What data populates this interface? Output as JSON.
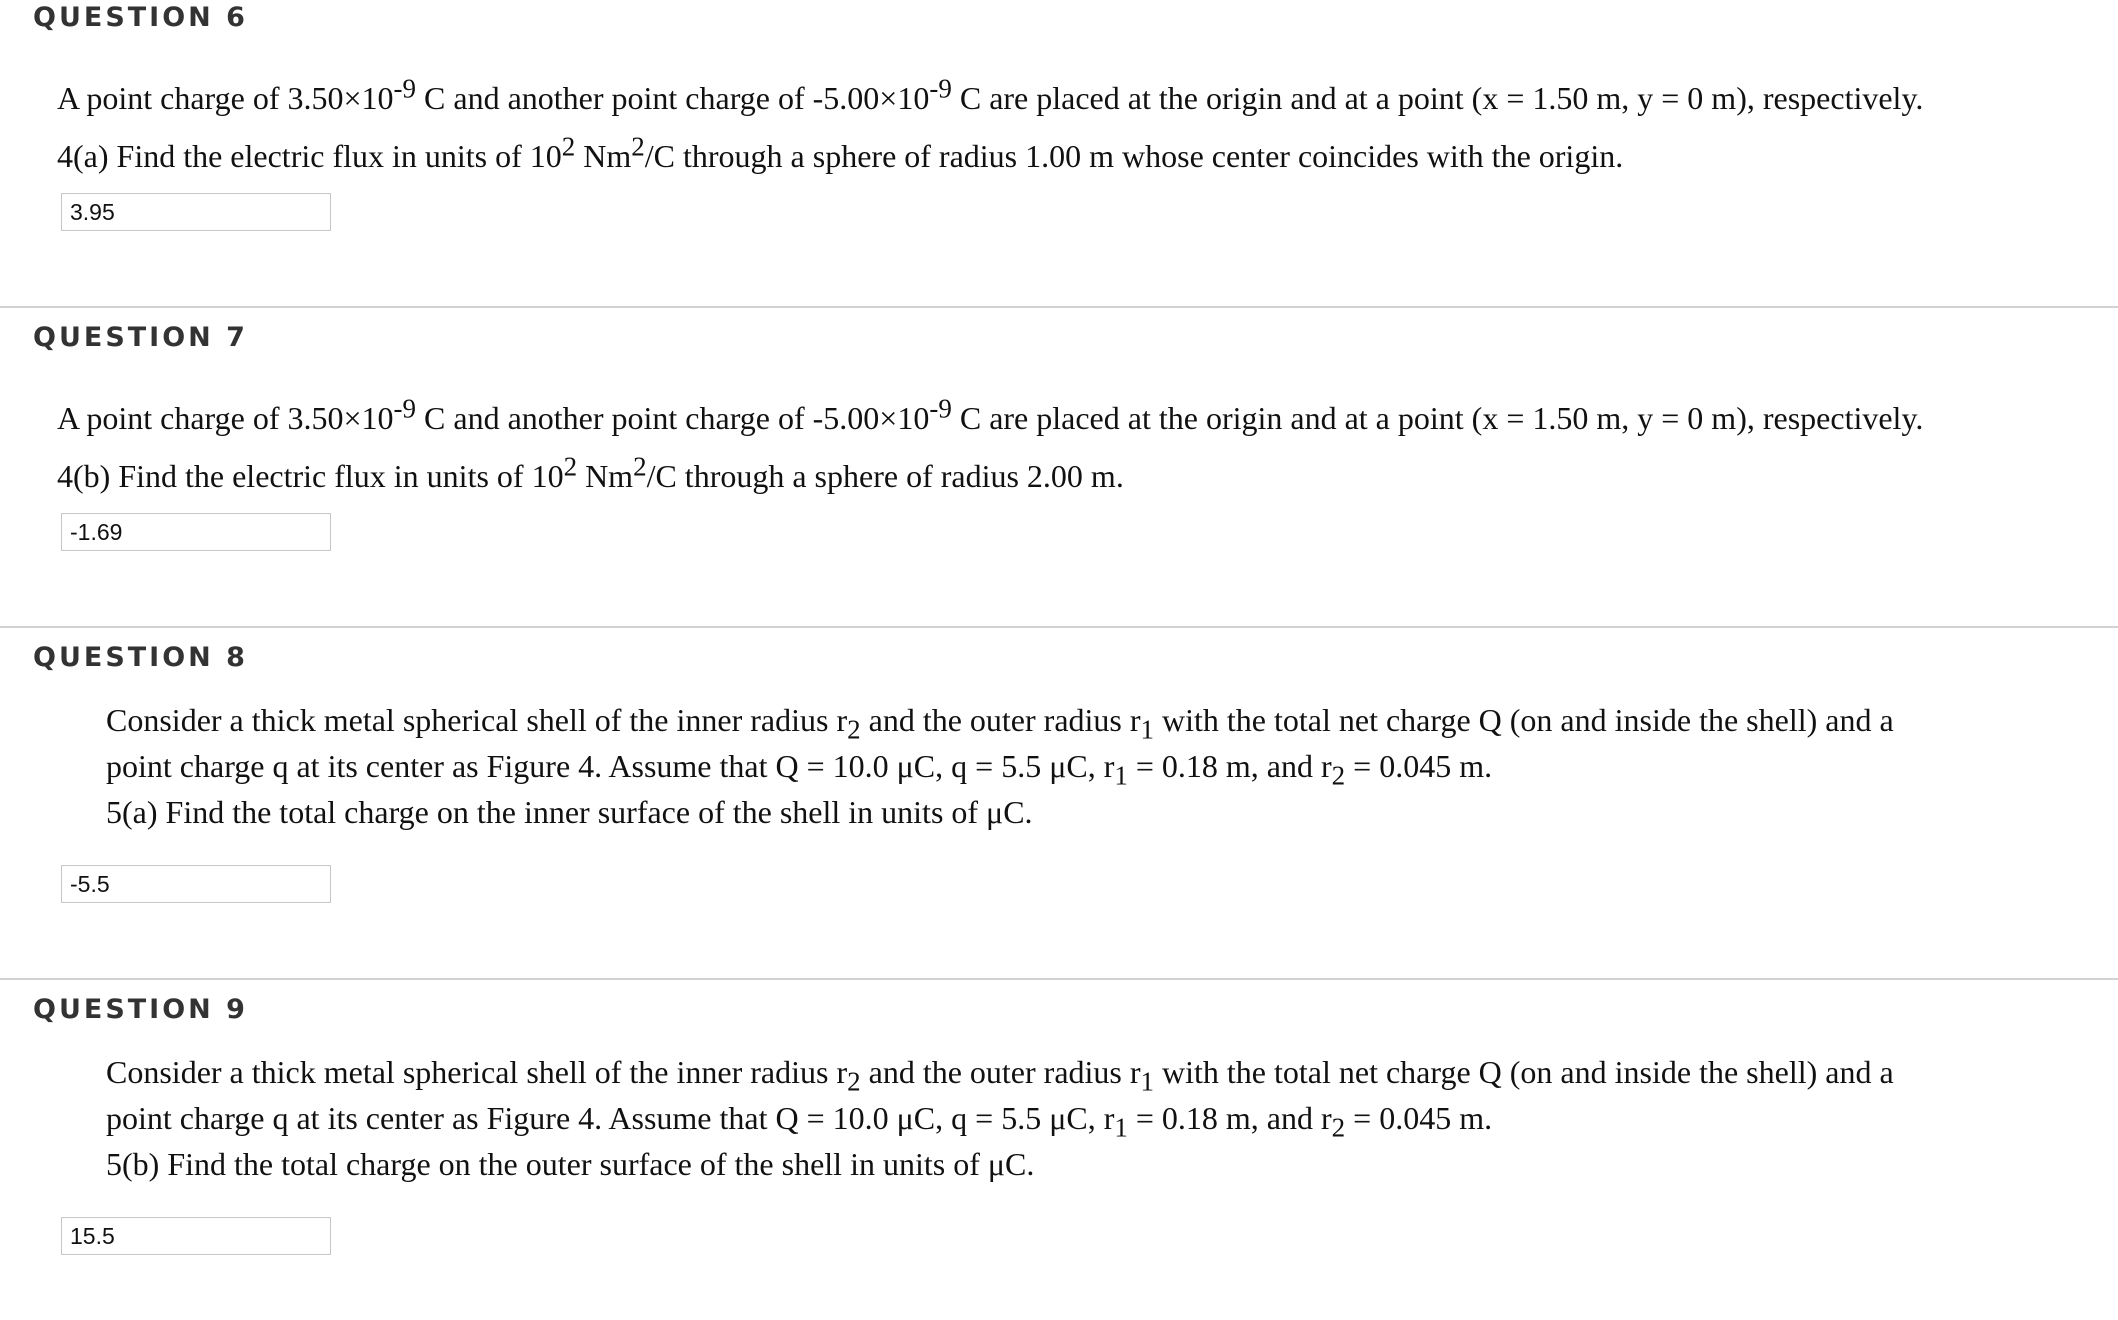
{
  "questions": [
    {
      "title": "QUESTION 6",
      "text_a": "A point charge of 3.50×10",
      "sup_a": "-9",
      "text_b": " C and another point charge of -5.00×10",
      "sup_b": "-9",
      "text_c": " C are placed at the origin and at a point (x = 1.50 m, y = 0 m), respectively.",
      "prompt_a": "4(a) Find the electric flux in units of 10",
      "prompt_sup1": "2",
      "prompt_b": " Nm",
      "prompt_sup2": "2",
      "prompt_c": "/C through a sphere of radius 1.00 m whose center coincides with the origin.",
      "answer": "3.95"
    },
    {
      "title": "QUESTION 7",
      "text_a": "A point charge of 3.50×10",
      "sup_a": "-9",
      "text_b": " C and another point charge of -5.00×10",
      "sup_b": "-9",
      "text_c": " C are placed at the origin and at a point (x = 1.50 m, y = 0 m), respectively.",
      "prompt_a": "4(b) Find the electric flux in units of 10",
      "prompt_sup1": "2",
      "prompt_b": " Nm",
      "prompt_sup2": "2",
      "prompt_c": "/C through a sphere of radius 2.00 m.",
      "answer": "-1.69"
    },
    {
      "title": "QUESTION 8",
      "line1_a": "Consider a thick metal spherical shell of the inner radius r",
      "line1_sub1": "2",
      "line1_b": " and the outer radius r",
      "line1_sub2": "1",
      "line1_c": " with the total net charge Q (on and inside the shell) and a",
      "line2_a": "point charge q at its center as Figure 4. Assume that Q = 10.0 μC, q = 5.5 μC, r",
      "line2_sub1": "1",
      "line2_b": " = 0.18 m, and r",
      "line2_sub2": "2",
      "line2_c": " = 0.045 m.",
      "line3": "5(a) Find the total charge on the inner surface of the shell in units of μC.",
      "answer": "-5.5"
    },
    {
      "title": "QUESTION 9",
      "line1_a": "Consider a thick metal spherical shell of the inner radius r",
      "line1_sub1": "2",
      "line1_b": " and the outer radius r",
      "line1_sub2": "1",
      "line1_c": " with the total net charge Q (on and inside the shell) and a",
      "line2_a": "point charge q at its center as Figure 4. Assume that Q = 10.0 μC, q = 5.5 μC, r",
      "line2_sub1": "1",
      "line2_b": " = 0.18 m, and r",
      "line2_sub2": "2",
      "line2_c": " = 0.045 m.",
      "line3": "5(b) Find the total charge on the outer surface of the shell in units of μC.",
      "answer": "15.5"
    }
  ]
}
